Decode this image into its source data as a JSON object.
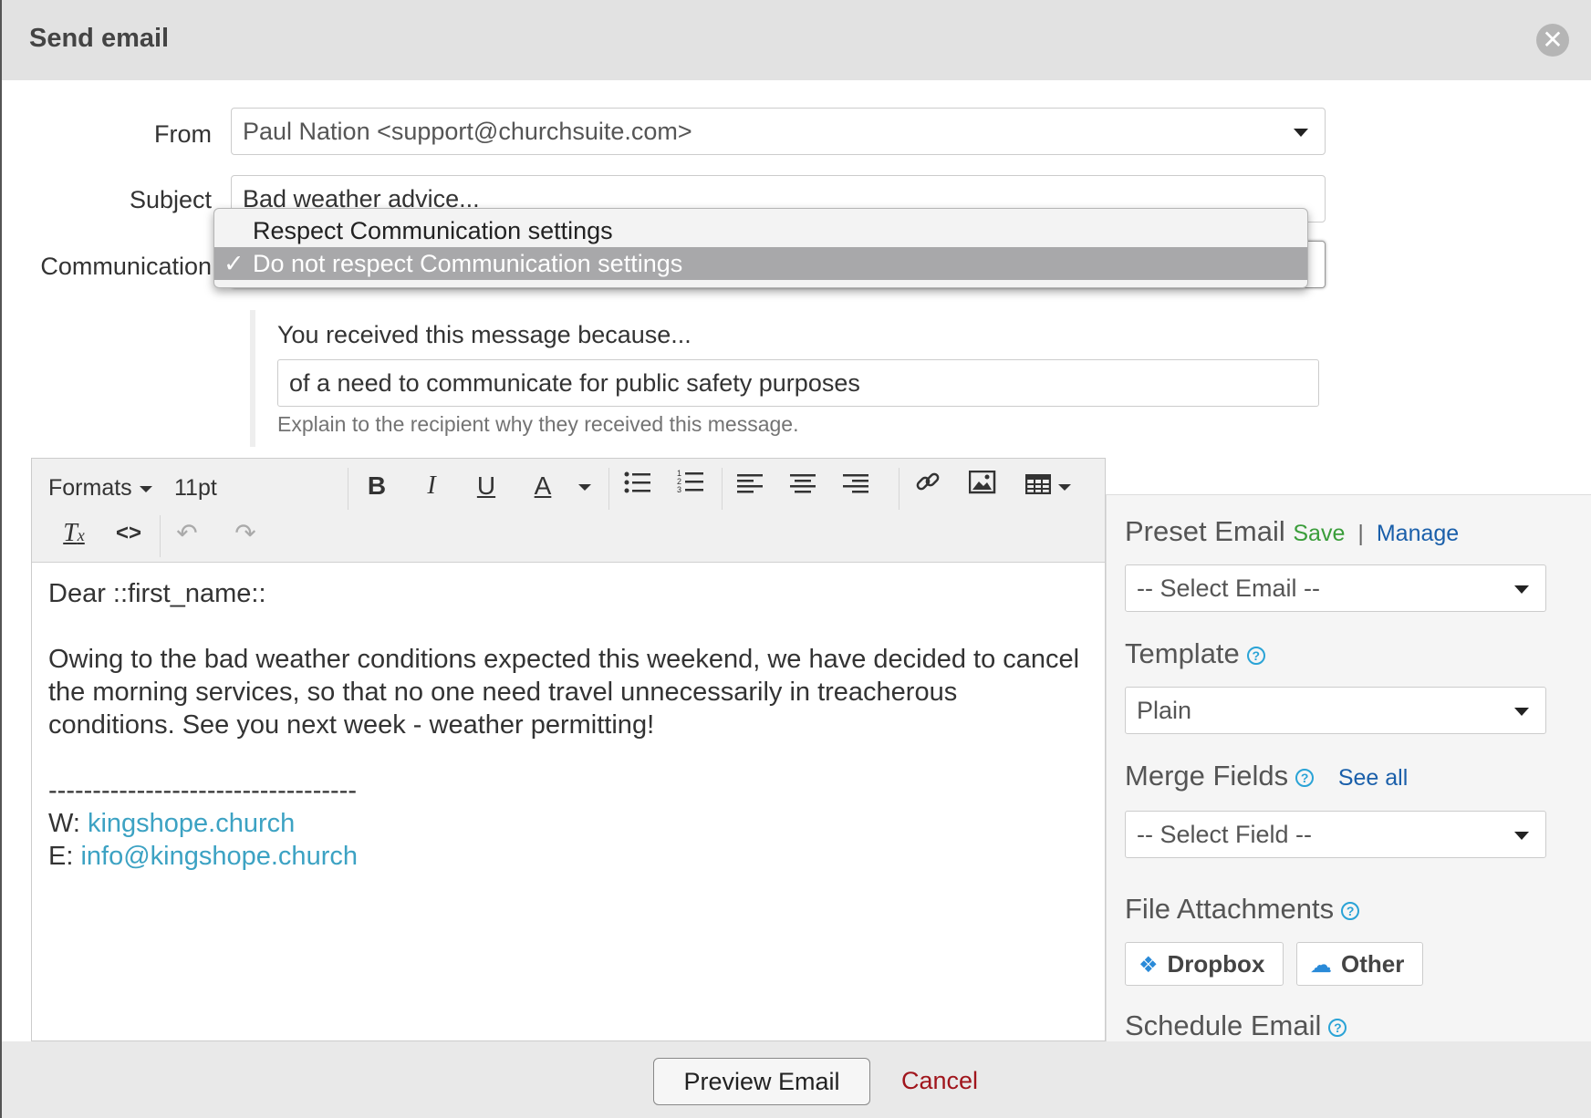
{
  "modal": {
    "title": "Send email",
    "close_glyph": "✕"
  },
  "form": {
    "from_label": "From",
    "from_value": "Paul Nation <support@churchsuite.com>",
    "subject_label": "Subject",
    "subject_value": "Bad weather advice...",
    "communication_label": "Communication",
    "communication_options": [
      "Respect Communication settings",
      "Do not respect Communication settings"
    ],
    "communication_selected": "Do not respect Communication settings",
    "check_glyph": "✓"
  },
  "reason": {
    "title": "You received this message because...",
    "value": "of a need to communicate for public safety purposes",
    "help": "Explain to the recipient why they received this message."
  },
  "editor": {
    "formats_label": "Formats",
    "font_size": "11pt",
    "bold": "B",
    "italic": "I",
    "underline": "U",
    "font_color": "A",
    "body": {
      "greeting": "Dear ::first_name::",
      "paragraph": "Owing to the bad weather conditions expected this weekend, we have decided to cancel the morning services, so that no one need travel unnecessarily in treacherous conditions. See you next week - weather permitting!",
      "divider": "-----------------------------------",
      "web_prefix": "W: ",
      "web_link": "kingshope.church",
      "email_prefix": "E: ",
      "email_link": "info@kingshope.church"
    }
  },
  "sidebar": {
    "preset_title": "Preset Email",
    "save_link": "Save",
    "pipe": "|",
    "manage_link": "Manage",
    "preset_placeholder": "-- Select Email --",
    "template_title": "Template",
    "template_value": "Plain",
    "merge_title": "Merge Fields",
    "see_all_link": "See all",
    "merge_placeholder": "-- Select Field --",
    "attachments_title": "File Attachments",
    "dropbox_label": "Dropbox",
    "other_label": "Other",
    "schedule_title": "Schedule Email",
    "help_glyph": "?"
  },
  "footer": {
    "preview_label": "Preview Email",
    "cancel_label": "Cancel"
  },
  "colors": {
    "accent_link": "#3ca2c3",
    "save_green": "#3a9d3a",
    "manage_blue": "#1a5faa",
    "cancel_red": "#a0151c"
  }
}
